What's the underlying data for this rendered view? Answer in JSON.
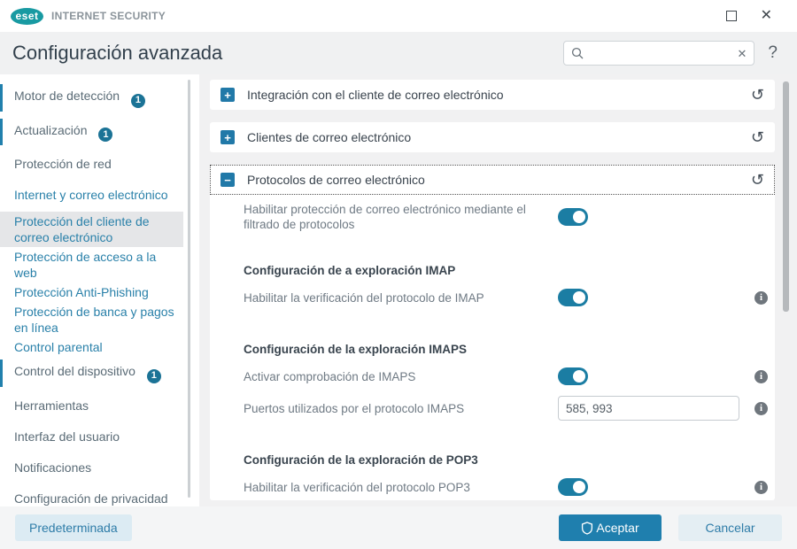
{
  "colors": {
    "brand_teal": "#189aa2",
    "accent_blue": "#2179a8",
    "toggle_on": "#1b7da3",
    "badge_blue": "#1b7396",
    "link_blue": "#2980a9",
    "selected_bg": "#e5e6e8",
    "content_bg": "#f1f1f2",
    "ok_button_blue": "#1f7fae"
  },
  "icons": {
    "expand": "+",
    "collapse": "−",
    "revert": "↺",
    "close": "✕",
    "clear": "✕"
  },
  "titlebar": {
    "brand": "eset",
    "product": "INTERNET SECURITY"
  },
  "header": {
    "title": "Configuración avanzada",
    "search_value": "",
    "help": "?"
  },
  "sidebar": {
    "items": [
      {
        "label": "Motor de detección",
        "badge": "1",
        "level": 1,
        "color": "gray",
        "attention": true
      },
      {
        "label": "Actualización",
        "badge": "1",
        "level": 1,
        "color": "gray",
        "attention": true
      },
      {
        "label": "Protección de red",
        "level": 1,
        "color": "gray"
      },
      {
        "label": "Internet y correo electrónico",
        "level": 1,
        "color": "blue"
      },
      {
        "label": "Protección del cliente de correo electrónico",
        "level": 2,
        "color": "blue",
        "selected": true
      },
      {
        "label": "Protección de acceso a la web",
        "level": 2,
        "color": "blue"
      },
      {
        "label": "Protección Anti-Phishing",
        "level": 2,
        "color": "blue"
      },
      {
        "label": "Protección de banca y pagos en línea",
        "level": 2,
        "color": "blue"
      },
      {
        "label": "Control parental",
        "level": 2,
        "color": "blue"
      },
      {
        "label": "Control del dispositivo",
        "badge": "1",
        "level": 1,
        "color": "gray",
        "attention": true
      },
      {
        "label": "Herramientas",
        "level": 1,
        "color": "gray"
      },
      {
        "label": "Interfaz del usuario",
        "level": 1,
        "color": "gray"
      },
      {
        "label": "Notificaciones",
        "level": 1,
        "color": "gray"
      },
      {
        "label": "Configuración de privacidad",
        "level": 1,
        "color": "gray"
      }
    ]
  },
  "content": {
    "sections": [
      {
        "title": "Integración con el cliente de correo electrónico",
        "expanded": false
      },
      {
        "title": "Clientes de correo electrónico",
        "expanded": false
      },
      {
        "title": "Protocolos de correo electrónico",
        "expanded": true,
        "focused": true,
        "rows": [
          {
            "type": "toggle",
            "label": "Habilitar protección de correo electrónico mediante el filtrado de protocolos",
            "on": true,
            "info": false
          },
          {
            "type": "subheader",
            "label": "Configuración de a exploración IMAP"
          },
          {
            "type": "toggle",
            "label": "Habilitar la verificación del protocolo de IMAP",
            "on": true,
            "info": true
          },
          {
            "type": "subheader",
            "label": "Configuración de la exploración IMAPS"
          },
          {
            "type": "toggle",
            "label": "Activar comprobación de IMAPS",
            "on": true,
            "info": true
          },
          {
            "type": "input",
            "label": "Puertos utilizados por el protocolo IMAPS",
            "value": "585, 993",
            "info": true
          },
          {
            "type": "subheader",
            "label": "Configuración de la exploración de POP3"
          },
          {
            "type": "toggle",
            "label": "Habilitar la verificación del protocolo POP3",
            "on": true,
            "info": true
          }
        ]
      }
    ]
  },
  "footer": {
    "default_label": "Predeterminada",
    "ok_label": "Aceptar",
    "cancel_label": "Cancelar"
  }
}
